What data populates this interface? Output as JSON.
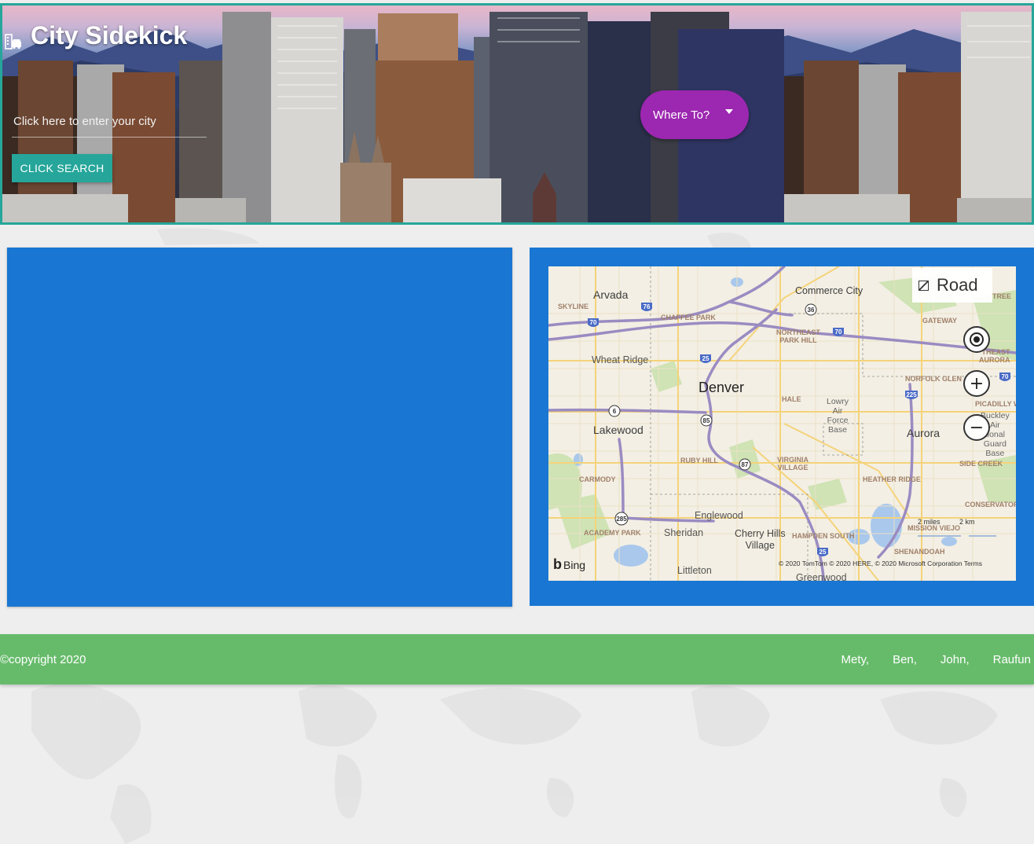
{
  "header": {
    "title": "City Sidekick",
    "city_input_placeholder": "Click here to enter your city",
    "search_button": "CLICK SEARCH",
    "where_button": "Where To?"
  },
  "map": {
    "style_button": "Road",
    "labels": {
      "arvada": "Arvada",
      "skyline": "SKYLINE",
      "chaffee_park": "CHAFFEE PARK",
      "commerce_city": "Commerce City",
      "gateway": "GATEWAY",
      "northeast_park_hill": "NORTHEAST\nPARK HILL",
      "wheat_ridge": "Wheat Ridge",
      "denver": "Denver",
      "hale": "HALE",
      "lowry": "Lowry\nAir\nForce\nBase",
      "norfolk_glen": "NORFOLK GLEN",
      "northeast_aurora": "THEAST\nAURORA",
      "picadilly": "PICADILLY W",
      "lakewood": "Lakewood",
      "aurora": "Aurora",
      "buckley": "Buckley\nAir\ntional\nGuard\nBase",
      "side_creek": "SIDE CREEK",
      "ruby_hill": "RUBY HILL",
      "virginia_village": "VIRGINIA\nVILLAGE",
      "carmody": "CARMODY",
      "heather_ridge": "HEATHER RIDGE",
      "conservatory": "CONSERVATOR",
      "englewood": "Englewood",
      "academy_park": "ACADEMY PARK",
      "sheridan": "Sheridan",
      "cherry_hills": "Cherry Hills\nVillage",
      "hampden_south": "HAMPDEN SOUTH",
      "mission_viejo": "MISSION VIEJO",
      "shenandoah": "SHENANDOAH",
      "littleton": "Littleton",
      "greenwood": "Greenwood",
      "tree": "TREE"
    },
    "shields": [
      "76",
      "70",
      "36",
      "70",
      "25",
      "70",
      "225",
      "6",
      "85",
      "87",
      "285",
      "25"
    ],
    "scale_miles": "2 miles",
    "scale_km": "2 km",
    "bing": "Bing",
    "attribution": "© 2020 TomTom © 2020 HERE, © 2020 Microsoft Corporation  Terms"
  },
  "footer": {
    "copyright": "©copyright 2020",
    "authors": [
      "Mety,",
      "Ben,",
      "John,",
      "Raufun"
    ]
  },
  "colors": {
    "teal": "#26a69a",
    "purple": "#9c27b0",
    "blue": "#1976d2",
    "green": "#66bb6a"
  },
  "icons": {
    "brand": "car-building-icon",
    "dropdown": "caret-down-icon",
    "locate": "locate-icon",
    "zoom_in": "zoom-in-icon",
    "zoom_out": "zoom-out-icon"
  }
}
